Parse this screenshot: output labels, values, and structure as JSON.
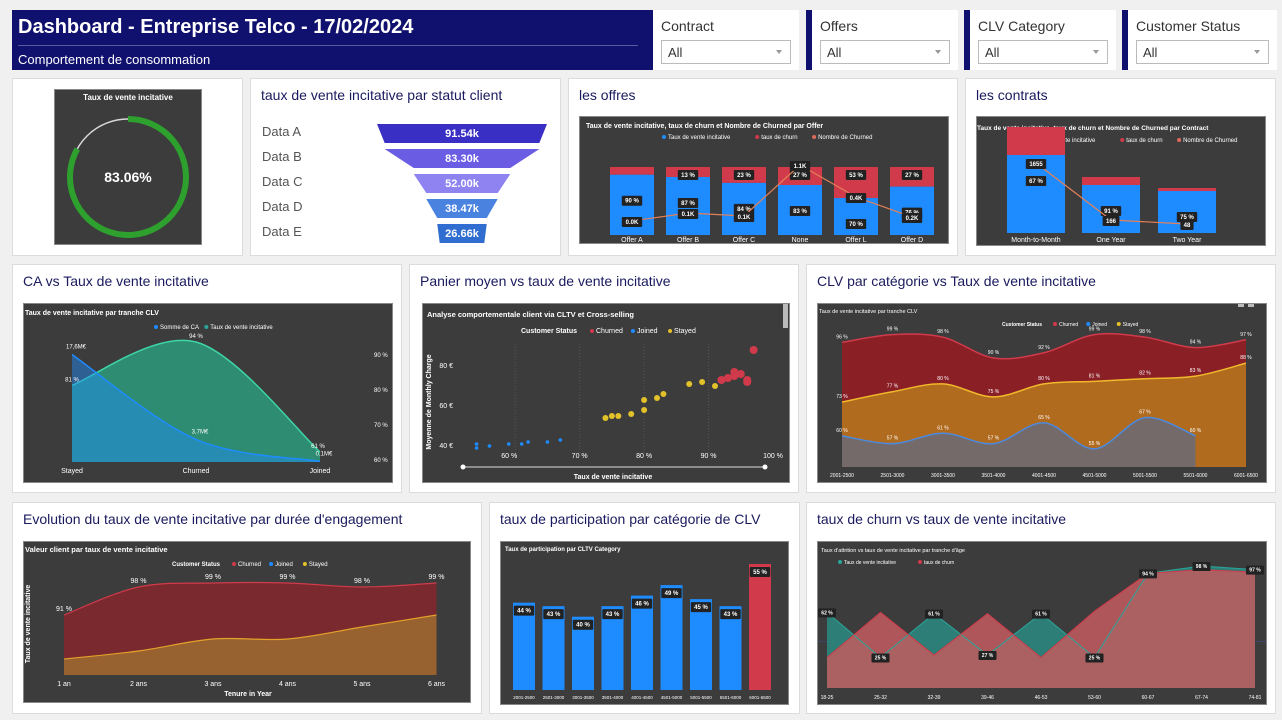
{
  "header": {
    "title": "Dashboard - Entreprise Telco - 17/02/2024",
    "subtitle": "Comportement de consommation"
  },
  "filters": [
    {
      "label": "Contract",
      "value": "All"
    },
    {
      "label": "Offers",
      "value": "All"
    },
    {
      "label": "CLV Category",
      "value": "All"
    },
    {
      "label": "Customer Status",
      "value": "All"
    }
  ],
  "colors": {
    "navy": "#10106e",
    "green": "#2ea02e",
    "blue": "#1e8cff",
    "red": "#d13a4a",
    "orange": "#e3a12a",
    "teal": "#2aa69a"
  },
  "cards": {
    "gauge": {
      "title": "Taux de vente incitative"
    },
    "funnel": {
      "title": "taux de vente incitative par statut client"
    },
    "offers": {
      "title": "les offres"
    },
    "contracts": {
      "title": "les contrats"
    },
    "ca": {
      "title": "CA vs Taux de vente incitative"
    },
    "panier": {
      "title": "Panier moyen vs taux de vente incitative"
    },
    "clv": {
      "title": "CLV par catégorie vs Taux de vente incitative"
    },
    "tenure": {
      "title": "Evolution du taux de vente incitative par durée d'engagement"
    },
    "participation": {
      "title": "taux de participation par catégorie de CLV"
    },
    "churn": {
      "title": "taux de churn vs taux de vente incitative"
    }
  },
  "chart_data": [
    {
      "id": "gauge",
      "type": "gauge",
      "title": "Taux de vente incitative",
      "value": 83.06,
      "label": "83.06%"
    },
    {
      "id": "funnel",
      "type": "funnel",
      "title": "taux de vente incitative par statut client",
      "categories": [
        "Data A",
        "Data B",
        "Data C",
        "Data D",
        "Data E"
      ],
      "values": [
        91540,
        83300,
        52000,
        38470,
        26660
      ],
      "labels": [
        "91.54k",
        "83.30k",
        "52.00k",
        "38.47k",
        "26.66k"
      ]
    },
    {
      "id": "offers",
      "type": "bar",
      "title": "Taux de vente incitative, taux de churn et Nombre de Churned par Offer",
      "legend": [
        "Taux de vente incitative",
        "taux de churn",
        "Nombre de Churned"
      ],
      "categories": [
        "Offer A",
        "Offer B",
        "Offer C",
        "None",
        "Offer L",
        "Offer D"
      ],
      "series": [
        {
          "name": "Taux de vente incitative",
          "values": [
            90,
            87,
            84,
            83,
            70,
            76
          ],
          "labels": [
            "90 %",
            "87 %",
            "84 %",
            "83 %",
            "70 %",
            "76 %"
          ]
        },
        {
          "name": "taux de churn",
          "values": [
            10,
            13,
            23,
            27,
            53,
            27
          ],
          "labels": [
            "",
            "13 %",
            "23 %",
            "27 %",
            "53 %",
            "27 %"
          ]
        },
        {
          "name": "Nombre de Churned",
          "labels": [
            "0.0K",
            "0.1K",
            "0.1K",
            "1.1K",
            "0.4K",
            "0.2K"
          ]
        }
      ]
    },
    {
      "id": "contracts",
      "type": "bar",
      "title": "Taux de vente incitative, taux de churn et Nombre de Churned par Contract",
      "legend": [
        "Taux de vente incitative",
        "taux de churn",
        "Nombre de Churned"
      ],
      "categories": [
        "Month-to-Month",
        "One Year",
        "Two Year"
      ],
      "series": [
        {
          "name": "Taux de vente incitative",
          "values": [
            67,
            91,
            75
          ],
          "labels": [
            "67 %",
            "91 %",
            "75 %"
          ]
        },
        {
          "name": "taux de churn",
          "values": [
            33,
            9,
            3
          ]
        },
        {
          "name": "Nombre de Churned",
          "labels": [
            "1655",
            "166",
            "48"
          ]
        }
      ]
    },
    {
      "id": "ca",
      "type": "area",
      "title": "Taux de vente incitative par tranche CLV",
      "legend": [
        "Somme de CA",
        "Taux de vente incitative"
      ],
      "categories": [
        "Stayed",
        "Churned",
        "Joined"
      ],
      "series": [
        {
          "name": "Somme de CA",
          "values": [
            17.6,
            3.7,
            0.1
          ],
          "labels": [
            "17,6M€",
            "3,7M€",
            "0,1M€"
          ]
        },
        {
          "name": "Taux de vente incitative",
          "values": [
            81,
            94,
            61
          ],
          "labels": [
            "81 %",
            "94 %",
            "61 %"
          ]
        }
      ],
      "y2ticks": [
        "90 %",
        "80 %",
        "70 %",
        "60 %"
      ]
    },
    {
      "id": "panier",
      "type": "scatter",
      "title": "Analyse comportementale client via CLTV et Cross-selling",
      "legend_title": "Customer Status",
      "legend": [
        "Churned",
        "Joined",
        "Stayed"
      ],
      "xlabel": "Taux de vente incitative",
      "ylabel": "Moyenne de Monthly Charge",
      "xticks": [
        "60 %",
        "70 %",
        "80 %",
        "90 %",
        "100 %"
      ],
      "yticks": [
        "80 €",
        "60 €",
        "40 €"
      ],
      "series": [
        {
          "name": "Joined",
          "points": [
            [
              54,
              40
            ],
            [
              54,
              42
            ],
            [
              56,
              41
            ],
            [
              59,
              42
            ],
            [
              61,
              42
            ],
            [
              62,
              43
            ],
            [
              65,
              43
            ],
            [
              67,
              44
            ]
          ]
        },
        {
          "name": "Stayed",
          "points": [
            [
              74,
              55
            ],
            [
              75,
              56
            ],
            [
              76,
              56
            ],
            [
              78,
              57
            ],
            [
              80,
              59
            ],
            [
              80,
              64
            ],
            [
              82,
              65
            ],
            [
              83,
              67
            ],
            [
              87,
              72
            ],
            [
              89,
              73
            ],
            [
              91,
              71
            ]
          ]
        },
        {
          "name": "Churned",
          "points": [
            [
              92,
              74
            ],
            [
              93,
              75
            ],
            [
              94,
              76
            ],
            [
              94,
              78
            ],
            [
              95,
              77
            ],
            [
              96,
              73
            ],
            [
              96,
              74
            ],
            [
              97,
              89
            ]
          ]
        }
      ]
    },
    {
      "id": "clv",
      "type": "area",
      "title": "Taux de vente incitative par tranche CLV",
      "legend_title": "Customer Status",
      "legend": [
        "Churned",
        "Joined",
        "Stayed"
      ],
      "categories": [
        "2001-2500",
        "2501-3000",
        "3001-3500",
        "3501-4000",
        "4001-4500",
        "4501-5000",
        "5001-5500",
        "5501-6000",
        "6001-6500"
      ],
      "series": [
        {
          "name": "Churned",
          "values": [
            96,
            99,
            98,
            90,
            92,
            99,
            98,
            94,
            97
          ],
          "labels": [
            "96 %",
            "99 %",
            "98 %",
            "90 %",
            "92 %",
            "99 %",
            "98 %",
            "94 %",
            "97 %"
          ]
        },
        {
          "name": "Stayed",
          "values": [
            73,
            77,
            80,
            75,
            80,
            81,
            82,
            83,
            88
          ],
          "labels": [
            "73 %",
            "77 %",
            "80 %",
            "75 %",
            "80 %",
            "81 %",
            "82 %",
            "83 %",
            "88 %"
          ]
        },
        {
          "name": "Joined",
          "values": [
            60,
            57,
            61,
            57,
            65,
            55,
            67,
            60,
            null
          ],
          "labels": [
            "60 %",
            "57 %",
            "61 %",
            "57 %",
            "65 %",
            "55 %",
            "67 %",
            "60 %",
            ""
          ]
        }
      ]
    },
    {
      "id": "tenure",
      "type": "area",
      "title": "Valeur client par taux de vente incitative",
      "legend_title": "Customer Status",
      "legend": [
        "Churned",
        "Joined",
        "Stayed"
      ],
      "xlabel": "Tenure in Year",
      "ylabel": "Taux de vente incitative",
      "categories": [
        "1 an",
        "2 ans",
        "3 ans",
        "4 ans",
        "5 ans",
        "6 ans"
      ],
      "series": [
        {
          "name": "Churned",
          "values": [
            91,
            98,
            99,
            99,
            98,
            99
          ],
          "labels": [
            "91 %",
            "98 %",
            "99 %",
            "99 %",
            "98 %",
            "99 %"
          ]
        },
        {
          "name": "Stayed",
          "values": [
            80,
            82,
            85,
            85,
            88,
            91
          ]
        }
      ]
    },
    {
      "id": "participation",
      "type": "bar",
      "title": "Taux de participation par CLTV Category",
      "categories": [
        "2001-2500",
        "2501-3000",
        "3001-3500",
        "3501-4000",
        "4001-4500",
        "4501-5000",
        "5001-5500",
        "5501-6000",
        "6001-6500"
      ],
      "values": [
        44,
        43,
        40,
        43,
        46,
        49,
        45,
        43,
        55
      ],
      "labels": [
        "44 %",
        "43 %",
        "40 %",
        "43 %",
        "46 %",
        "49 %",
        "45 %",
        "43 %",
        "55 %"
      ]
    },
    {
      "id": "churn",
      "type": "area",
      "title": "Taux d'attrition vs taux de vente incitative par tranche d'âge",
      "legend": [
        "Taux de vente incitative",
        "taux de churn"
      ],
      "categories": [
        "18-25",
        "25-32",
        "32-39",
        "39-46",
        "46-53",
        "53-60",
        "60-67",
        "67-74",
        "74-81"
      ],
      "series": [
        {
          "name": "Taux de vente incitative",
          "values": [
            62,
            25,
            61,
            27,
            61,
            25,
            94,
            100,
            97
          ],
          "labels": [
            "62 %",
            "25 %",
            "61 %",
            "27 %",
            "61 %",
            "25 %",
            "94 %",
            "98 %",
            "97 %"
          ]
        },
        {
          "name": "taux de churn",
          "values": [
            25,
            62,
            27,
            61,
            25,
            63,
            94,
            97,
            95
          ],
          "labels": [
            "",
            "",
            "",
            "",
            "",
            "",
            "",
            "",
            ""
          ]
        }
      ]
    }
  ]
}
